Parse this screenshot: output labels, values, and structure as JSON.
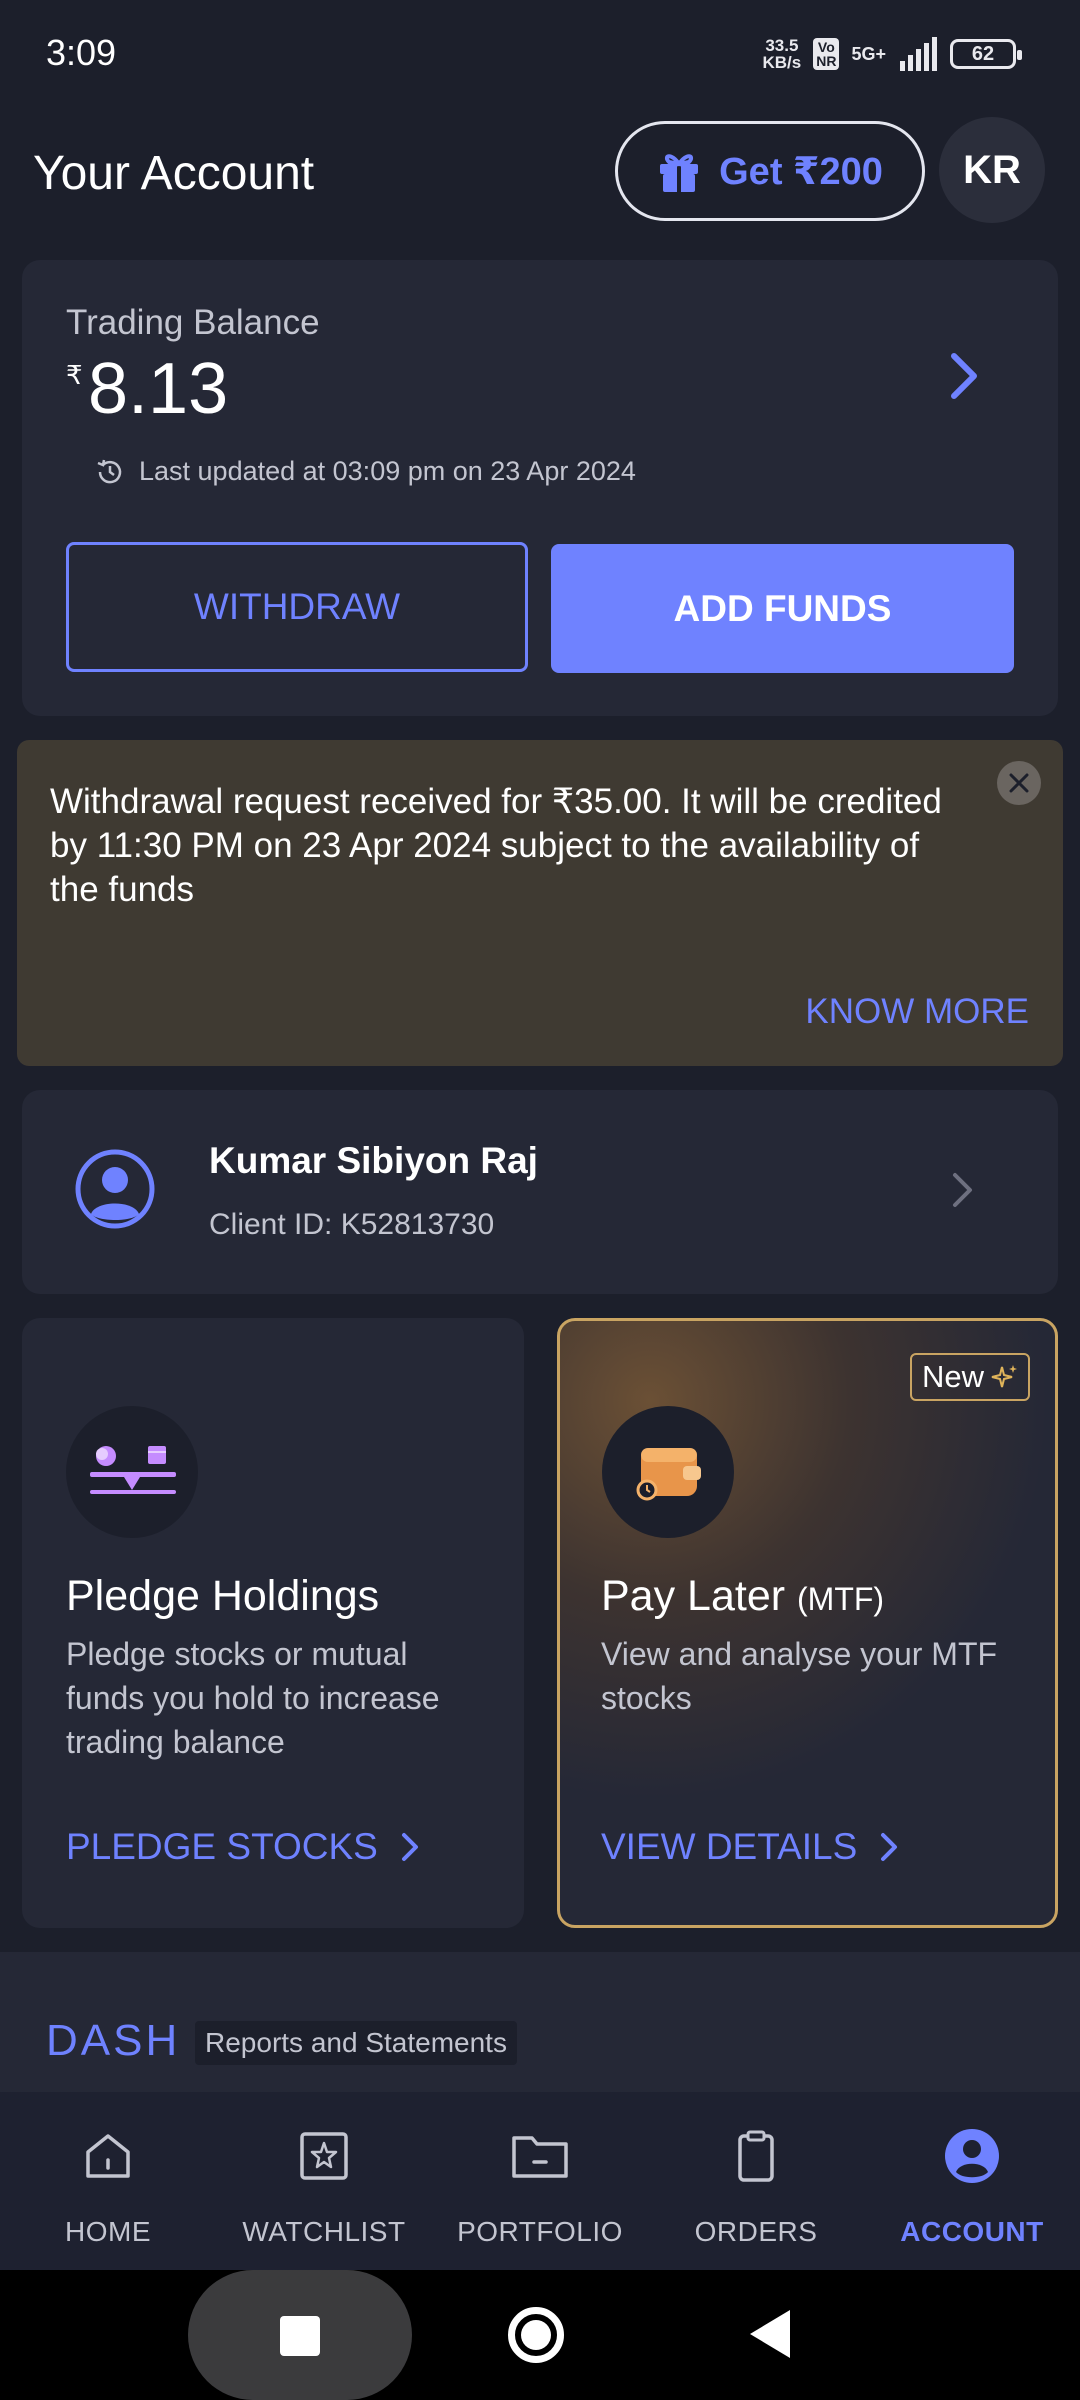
{
  "status_bar": {
    "time": "3:09",
    "net_speed_value": "33.5",
    "net_speed_unit": "KB/s",
    "volte_top": "Vo",
    "volte_bottom": "NR",
    "network": "5G+",
    "battery": "62"
  },
  "header": {
    "title": "Your Account",
    "refer_label": "Get ₹200",
    "avatar_initials": "KR"
  },
  "balance": {
    "label": "Trading Balance",
    "currency": "₹",
    "value": "8.13",
    "last_updated": "Last updated at 03:09 pm on 23 Apr 2024",
    "withdraw_label": "WITHDRAW",
    "add_funds_label": "ADD FUNDS"
  },
  "notice": {
    "text": "Withdrawal request received for ₹35.00. It will be credited by 11:30 PM on 23 Apr 2024 subject to the availability of the funds",
    "action_label": "KNOW MORE"
  },
  "profile": {
    "name": "Kumar Sibiyon Raj",
    "client_id": "Client ID: K52813730"
  },
  "features": {
    "pledge": {
      "title": "Pledge Holdings",
      "description": "Pledge stocks or mutual funds you hold to increase trading balance",
      "link_label": "PLEDGE STOCKS"
    },
    "pay_later": {
      "badge": "New",
      "title": "Pay Later",
      "title_suffix": "(MTF)",
      "description": "View and analyse your MTF stocks",
      "link_label": "VIEW DETAILS"
    }
  },
  "dash": {
    "logo": "DASH",
    "tag": "Reports and Statements"
  },
  "bottom_nav": {
    "items": [
      {
        "label": "HOME",
        "icon": "home-icon"
      },
      {
        "label": "WATCHLIST",
        "icon": "watchlist-icon"
      },
      {
        "label": "PORTFOLIO",
        "icon": "portfolio-icon"
      },
      {
        "label": "ORDERS",
        "icon": "orders-icon"
      },
      {
        "label": "ACCOUNT",
        "icon": "account-icon"
      }
    ],
    "active": "ACCOUNT"
  },
  "colors": {
    "background": "#1c1f2b",
    "card": "#252836",
    "accent": "#6f82ff",
    "notice_bg": "#3f3a32",
    "gold_border": "#c9a462"
  }
}
